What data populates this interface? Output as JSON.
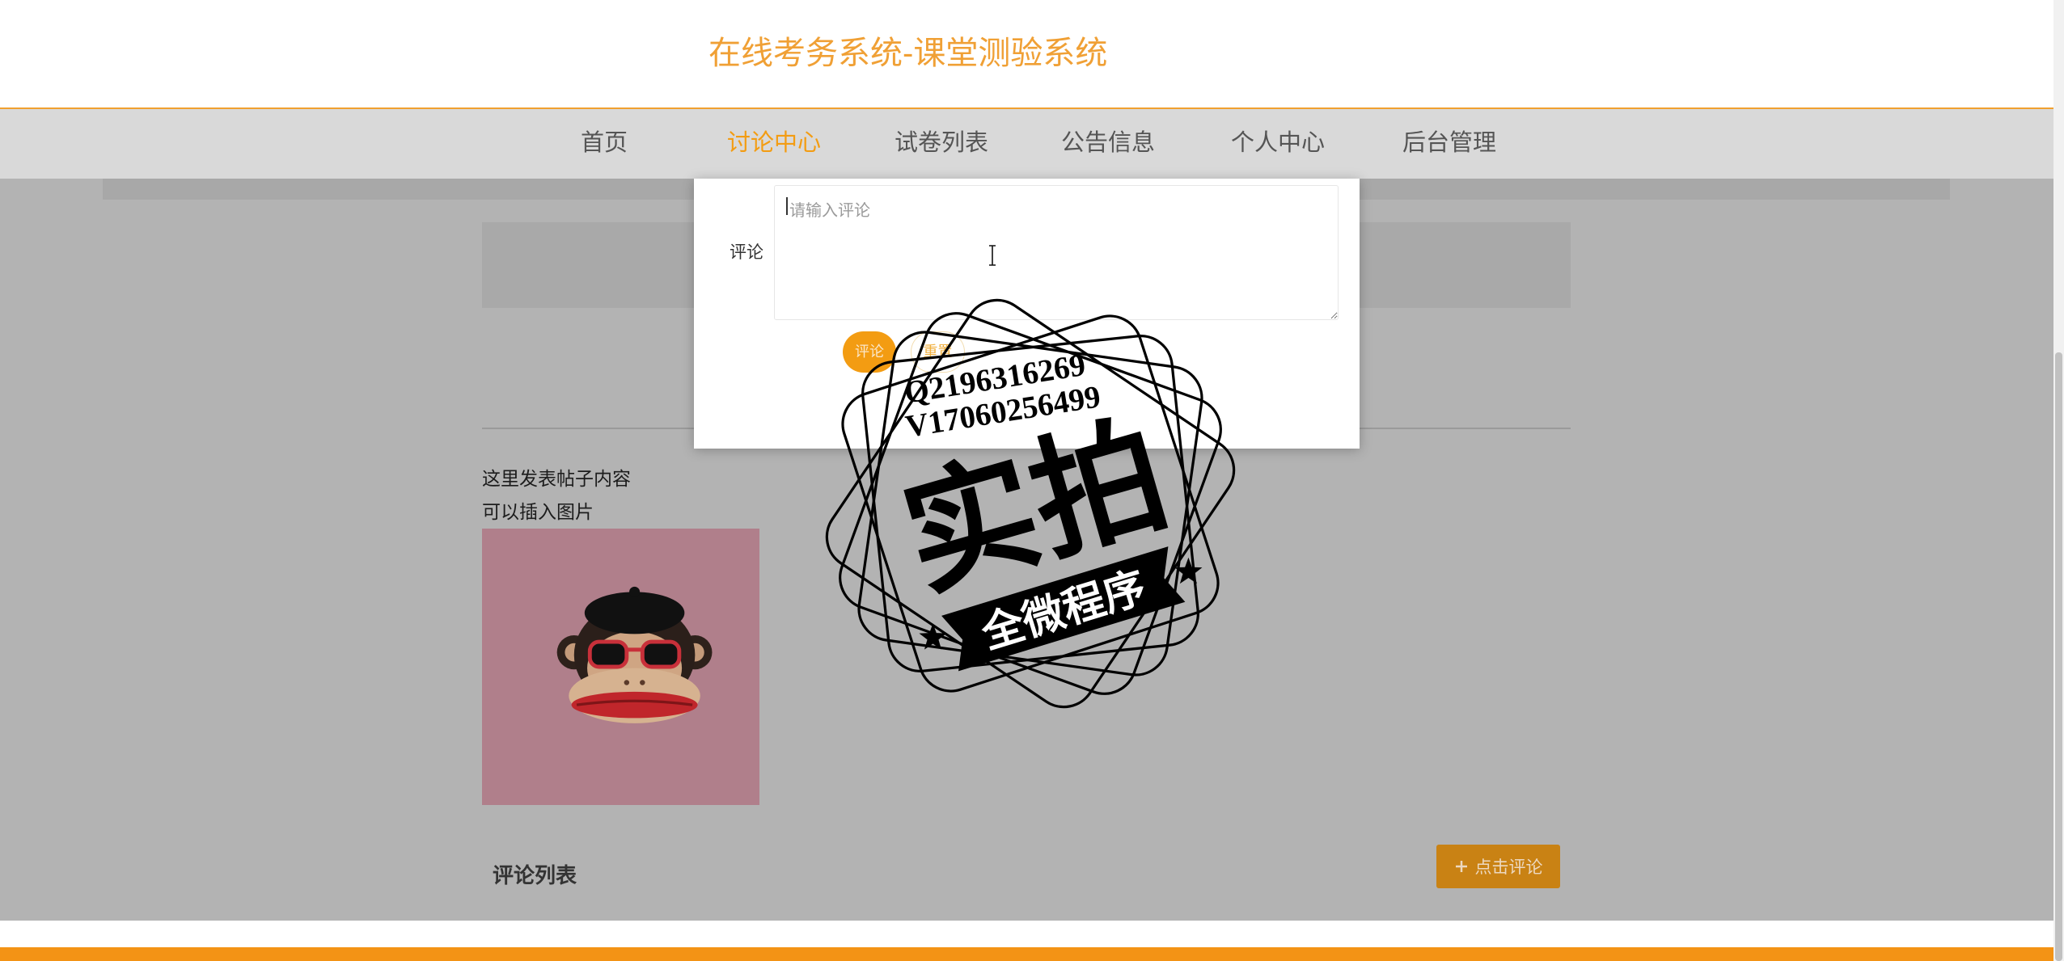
{
  "header": {
    "title": "在线考务系统-课堂测验系统"
  },
  "nav": {
    "items": [
      {
        "label": "首页",
        "active": false
      },
      {
        "label": "讨论中心",
        "active": true
      },
      {
        "label": "试卷列表",
        "active": false
      },
      {
        "label": "公告信息",
        "active": false
      },
      {
        "label": "个人中心",
        "active": false
      },
      {
        "label": "后台管理",
        "active": false
      }
    ]
  },
  "post": {
    "content_lines": [
      "这里发表帖子内容",
      "可以插入图片"
    ],
    "image_icon": "monkey-with-sunglasses-illustration"
  },
  "comments": {
    "heading": "评论列表",
    "add_button_label": "点击评论",
    "add_button_icon": "plus-icon"
  },
  "modal": {
    "field_label": "评论",
    "textarea": {
      "placeholder": "请输入评论",
      "value": ""
    },
    "submit_label": "评论",
    "reset_label": "重置"
  },
  "watermark": {
    "lines": [
      "Q2196316269",
      "V17060256499"
    ],
    "main_text": "实拍",
    "banner_text": "全微程序"
  },
  "cursor": {
    "icon": "text-cursor-icon"
  },
  "colors": {
    "accent": "#f39c12",
    "title": "#f0a035",
    "nav_bg": "#d9d9d9",
    "overlay_bg": "#b3b3b3",
    "footer": "#f39315"
  }
}
